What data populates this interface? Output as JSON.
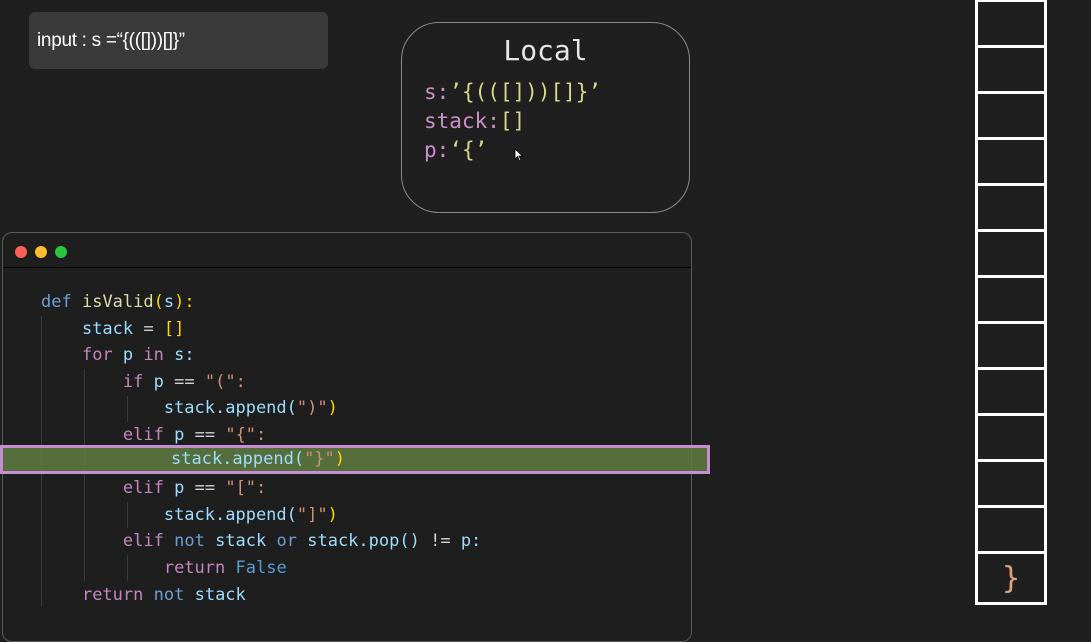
{
  "input": {
    "label": "input : s =“{(([]))[]}”"
  },
  "local": {
    "title": "Local",
    "vars": [
      {
        "name": "s",
        "value": "’{(([]))[]}’"
      },
      {
        "name": "stack",
        "value": "[]"
      },
      {
        "name": "p",
        "value": "‘{’"
      }
    ]
  },
  "code": {
    "lines": [
      [
        "def",
        "isValid",
        "(",
        "s",
        "):"
      ],
      [
        "stack",
        "=",
        "[]"
      ],
      [
        "for",
        "p",
        "in",
        "s:"
      ],
      [
        "if",
        "p",
        "==",
        "\"(\":"
      ],
      [
        "stack.append(",
        "\")\"",
        ")"
      ],
      [
        "elif",
        "p",
        "==",
        "\"{\":"
      ],
      [
        "stack.append(",
        "\"}\"",
        ")"
      ],
      [
        "elif",
        "p",
        "==",
        "\"[\":"
      ],
      [
        "stack.append(",
        "\"]\"",
        ")"
      ],
      [
        "elif",
        "not",
        "stack",
        "or",
        "stack.pop()",
        "!=",
        "p:"
      ],
      [
        "return",
        "False"
      ],
      [
        "return",
        "not",
        "stack"
      ]
    ]
  },
  "stack": {
    "top_value": "}",
    "cells": 13
  },
  "colors": {
    "highlight_border": "#c38fd2",
    "highlight_fill": "#5f7d41"
  }
}
